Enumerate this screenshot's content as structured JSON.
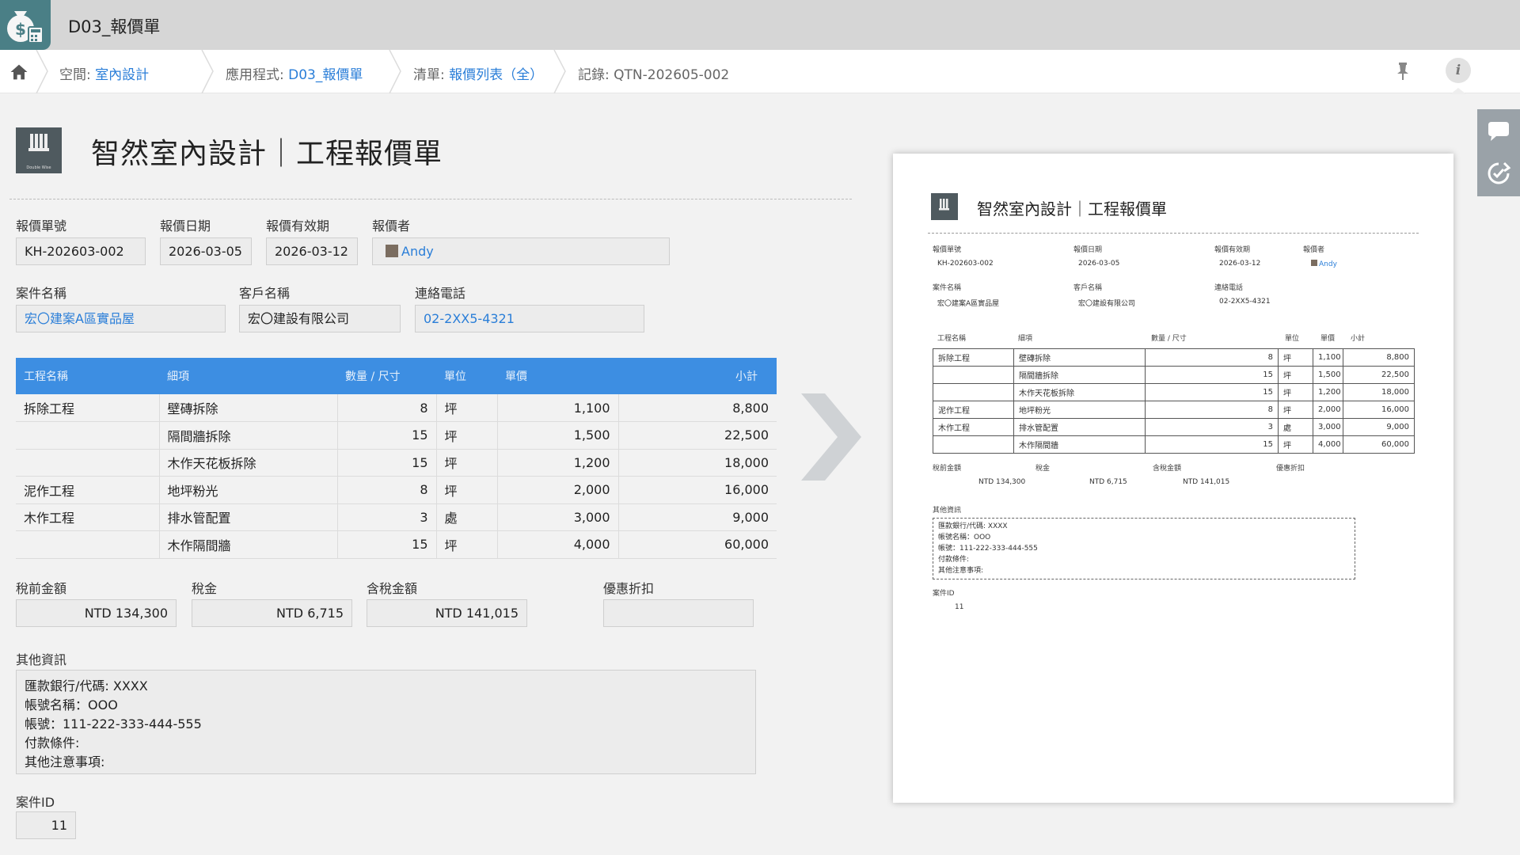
{
  "app": {
    "title": "D03_報價單",
    "icon": "money-bag-icon"
  },
  "breadcrumb": {
    "space_prefix": "空間: ",
    "space": "室內設計",
    "app_prefix": "應用程式: ",
    "app": "D03_報價單",
    "list_prefix": "清單: ",
    "list": "報價列表（全）",
    "record_prefix": "記錄: ",
    "record": "QTN-202605-002"
  },
  "header": {
    "logo_text": "Double Wise",
    "title": "智然室內設計｜工程報價單"
  },
  "fields": {
    "quote_no": {
      "label": "報價單號",
      "value": "KH-202603-002"
    },
    "quote_date": {
      "label": "報價日期",
      "value": "2026-03-05"
    },
    "valid_until": {
      "label": "報價有效期",
      "value": "2026-03-12"
    },
    "quoter": {
      "label": "報價者",
      "value": "Andy"
    },
    "case_name": {
      "label": "案件名稱",
      "value": "宏〇建案A區實品屋"
    },
    "client_name": {
      "label": "客戶名稱",
      "value": "宏〇建設有限公司"
    },
    "phone": {
      "label": "連絡電話",
      "value": "02-2XX5-4321"
    }
  },
  "table": {
    "headers": [
      "工程名稱",
      "細項",
      "數量 / 尺寸",
      "單位",
      "單價",
      "小計"
    ],
    "rows": [
      [
        "拆除工程",
        "壁磚拆除",
        "8",
        "坪",
        "1,100",
        "8,800"
      ],
      [
        "",
        "隔間牆拆除",
        "15",
        "坪",
        "1,500",
        "22,500"
      ],
      [
        "",
        "木作天花板拆除",
        "15",
        "坪",
        "1,200",
        "18,000"
      ],
      [
        "泥作工程",
        "地坪粉光",
        "8",
        "坪",
        "2,000",
        "16,000"
      ],
      [
        "木作工程",
        "排水管配置",
        "3",
        "處",
        "3,000",
        "9,000"
      ],
      [
        "",
        "木作隔間牆",
        "15",
        "坪",
        "4,000",
        "60,000"
      ]
    ]
  },
  "totals": {
    "pretax": {
      "label": "稅前金額",
      "value": "NTD 134,300"
    },
    "tax": {
      "label": "稅金",
      "value": "NTD 6,715"
    },
    "with_tax": {
      "label": "含稅金額",
      "value": "NTD 141,015"
    },
    "discount": {
      "label": "優惠折扣",
      "value": ""
    }
  },
  "other": {
    "label": "其他資訊",
    "lines": [
      "匯款銀行/代碼: XXXX",
      "帳號名稱：OOO",
      "帳號：111-222-333-444-555",
      "付款條件:",
      "其他注意事項:"
    ]
  },
  "case_id": {
    "label": "案件ID",
    "value": "11"
  },
  "preview": {
    "table_rows": [
      [
        "拆除工程",
        "壁磚拆除",
        "8",
        "坪",
        "1,100",
        "8,800"
      ],
      [
        "",
        "隔間牆拆除",
        "15",
        "坪",
        "1,500",
        "22,500"
      ],
      [
        "",
        "木作天花板拆除",
        "15",
        "坪",
        "1,200",
        "18,000"
      ],
      [
        "泥作工程",
        "地坪粉光",
        "8",
        "坪",
        "2,000",
        "16,000"
      ],
      [
        "木作工程",
        "排水管配置",
        "3",
        "處",
        "3,000",
        "9,000"
      ],
      [
        "",
        "木作隔間牆",
        "15",
        "坪",
        "4,000",
        "60,000"
      ]
    ],
    "notes_lines": [
      "匯款銀行/代碼: XXXX",
      "帳號名稱：OOO",
      "帳號：111-222-333-444-555",
      "付款條件:",
      "其他注意事項:"
    ]
  },
  "colors": {
    "accent": "#3d8ee2",
    "link": "#2a7ed8",
    "topbar": "#d6d6d6",
    "app_icon_bg": "#4a7f86"
  },
  "icons": [
    "home-icon",
    "pin-icon",
    "info-icon",
    "comment-icon",
    "history-icon",
    "next-arrow-icon"
  ]
}
